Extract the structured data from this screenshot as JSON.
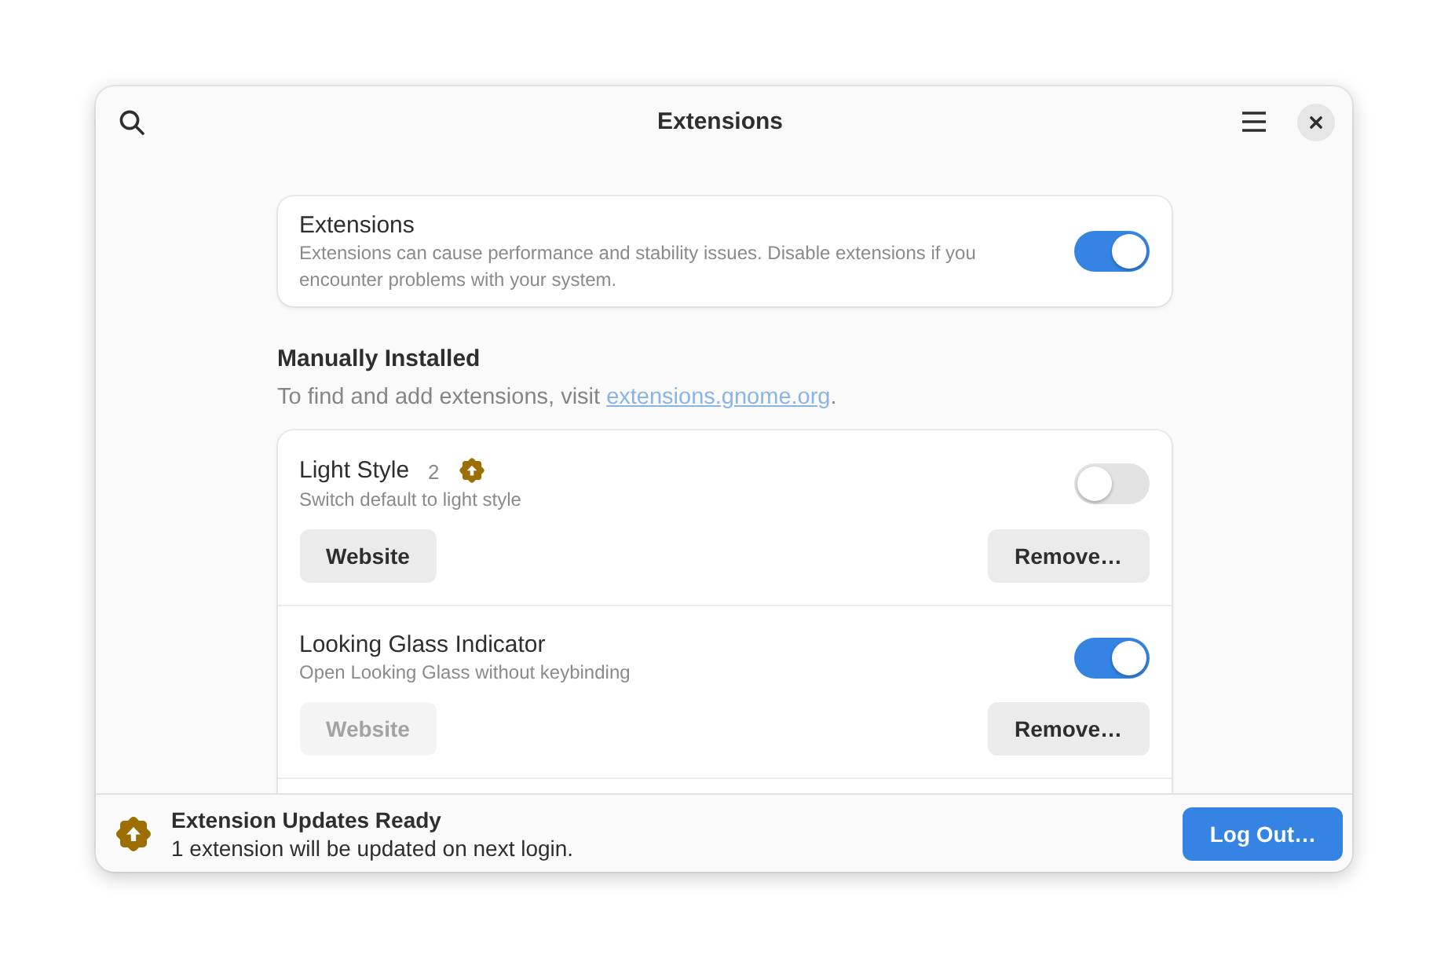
{
  "window": {
    "title": "Extensions"
  },
  "master_switch": {
    "title": "Extensions",
    "description": "Extensions can cause performance and stability issues. Disable extensions if you encounter problems with your system.",
    "on": true
  },
  "manually_installed": {
    "heading": "Manually Installed",
    "hint": "To find and add extensions, visit ",
    "link": "extensions.gnome.org",
    "hint_end": "."
  },
  "extensions": [
    {
      "name": "Light Style",
      "version": "2",
      "update_ready": true,
      "description": "Switch default to light style",
      "on": false,
      "website_button": {
        "label": "Website",
        "disabled": false
      },
      "remove_button": "Remove…"
    },
    {
      "name": "Looking Glass Indicator",
      "update_ready": false,
      "description": "Open Looking Glass without keybinding",
      "on": true,
      "website_button": {
        "label": "Website",
        "disabled": true
      },
      "remove_button": "Remove…"
    }
  ],
  "banner": {
    "title": "Extension Updates Ready",
    "message": "1 extension will be updated on next login.",
    "button": "Log Out…"
  }
}
